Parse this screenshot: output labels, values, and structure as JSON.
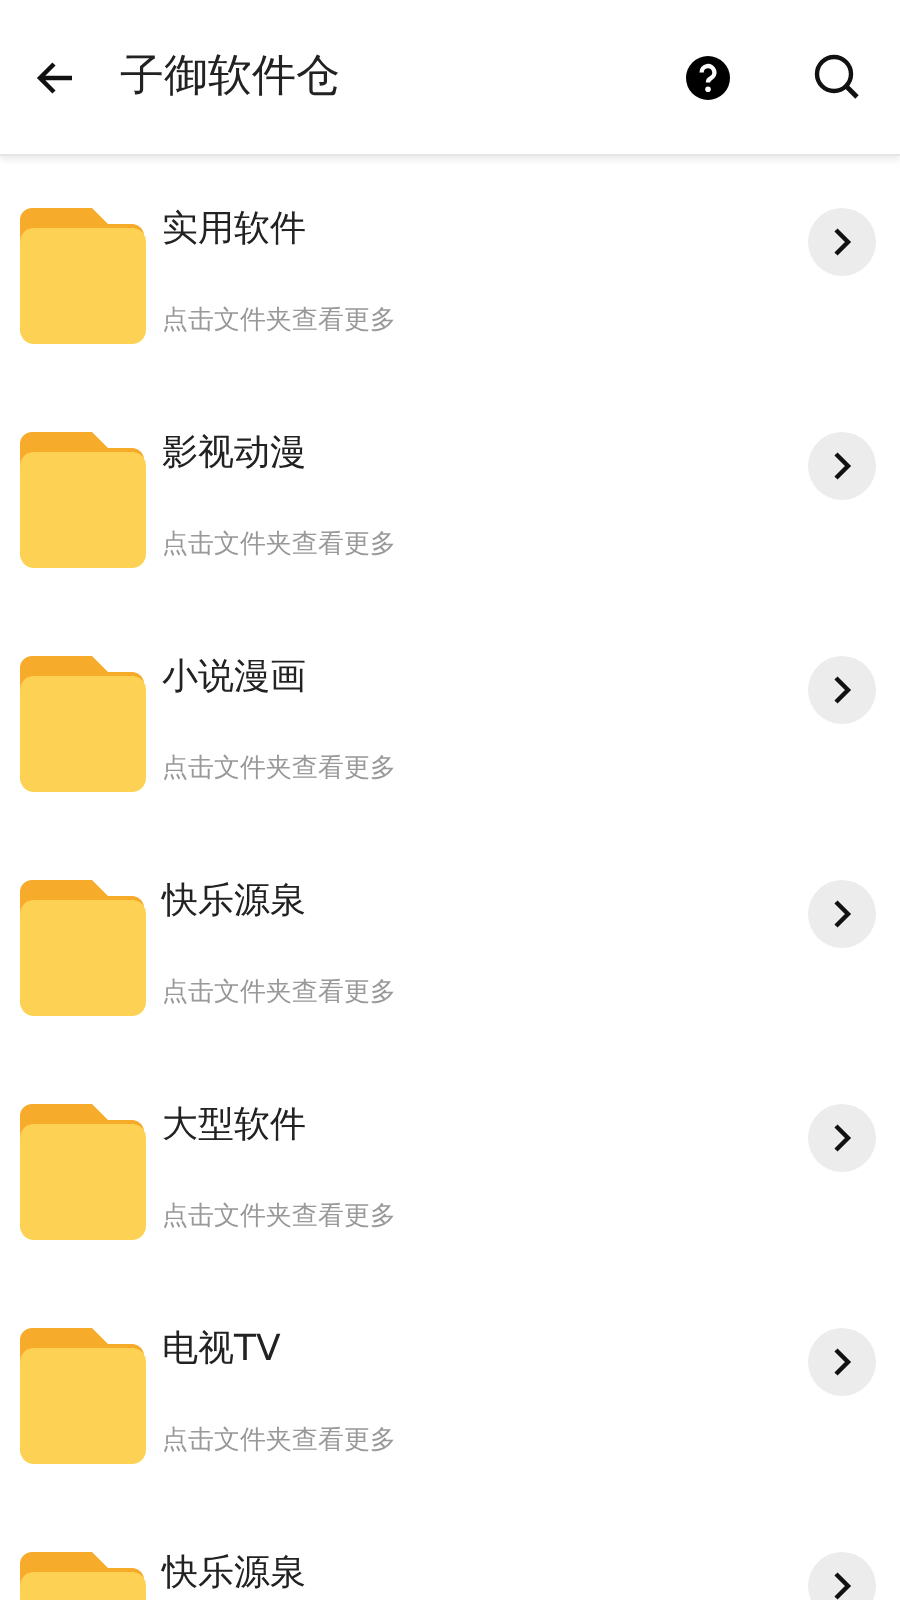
{
  "header": {
    "title": "子御软件仓"
  },
  "folders": [
    {
      "name": "实用软件",
      "hint": "点击文件夹查看更多"
    },
    {
      "name": "影视动漫",
      "hint": "点击文件夹查看更多"
    },
    {
      "name": "小说漫画",
      "hint": "点击文件夹查看更多"
    },
    {
      "name": "快乐源泉",
      "hint": "点击文件夹查看更多"
    },
    {
      "name": "大型软件",
      "hint": "点击文件夹查看更多"
    },
    {
      "name": "电视TV",
      "hint": "点击文件夹查看更多"
    },
    {
      "name": "快乐源泉"
    }
  ]
}
